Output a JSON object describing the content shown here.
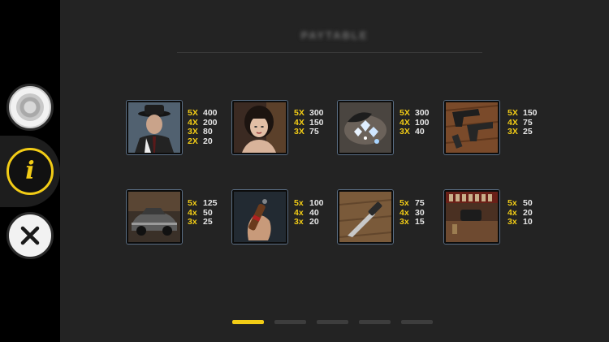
{
  "title": "PAYTABLE",
  "symbols": [
    {
      "name": "gangster",
      "pays": [
        [
          "5X",
          "400"
        ],
        [
          "4X",
          "200"
        ],
        [
          "3X",
          "80"
        ],
        [
          "2X",
          "20"
        ]
      ]
    },
    {
      "name": "woman",
      "pays": [
        [
          "5X",
          "300"
        ],
        [
          "4X",
          "150"
        ],
        [
          "3X",
          "75"
        ]
      ]
    },
    {
      "name": "diamonds",
      "pays": [
        [
          "5X",
          "300"
        ],
        [
          "4X",
          "100"
        ],
        [
          "3X",
          "40"
        ]
      ]
    },
    {
      "name": "pistols",
      "pays": [
        [
          "5X",
          "150"
        ],
        [
          "4X",
          "75"
        ],
        [
          "3X",
          "25"
        ]
      ]
    },
    {
      "name": "car",
      "pays": [
        [
          "5x",
          "125"
        ],
        [
          "4x",
          "50"
        ],
        [
          "3x",
          "25"
        ]
      ]
    },
    {
      "name": "cigar",
      "pays": [
        [
          "5x",
          "100"
        ],
        [
          "4x",
          "40"
        ],
        [
          "3x",
          "20"
        ]
      ]
    },
    {
      "name": "knife",
      "pays": [
        [
          "5x",
          "75"
        ],
        [
          "4x",
          "30"
        ],
        [
          "3x",
          "15"
        ]
      ]
    },
    {
      "name": "bar",
      "pays": [
        [
          "5x",
          "50"
        ],
        [
          "4x",
          "20"
        ],
        [
          "3x",
          "10"
        ]
      ]
    }
  ],
  "pager": {
    "pages": 5,
    "active": 0
  },
  "colors": {
    "accent": "#f2cc16",
    "panel": "#232323",
    "sidebar": "#000000"
  },
  "sidebar": {
    "buttons": [
      {
        "name": "settings",
        "icon": "settings-icon"
      },
      {
        "name": "info",
        "icon": "info-icon",
        "label": "i",
        "active": true
      },
      {
        "name": "close",
        "icon": "close-icon"
      }
    ]
  }
}
